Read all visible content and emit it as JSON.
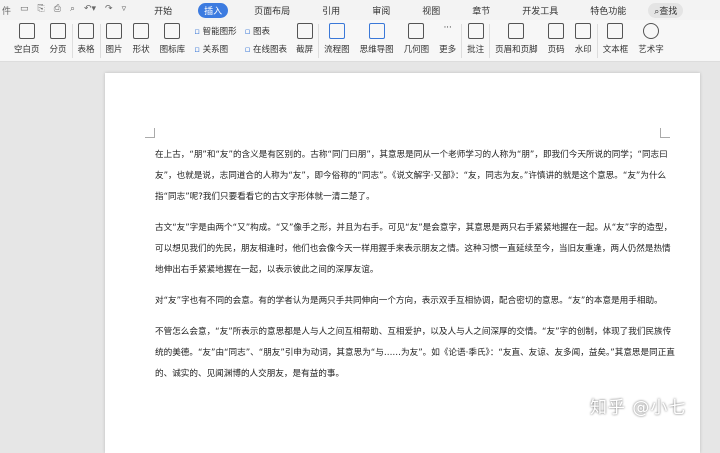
{
  "quick_access": {
    "file_label": "件"
  },
  "tabs": [
    "开始",
    "插入",
    "页面布局",
    "引用",
    "审阅",
    "视图",
    "章节",
    "开发工具",
    "特色功能"
  ],
  "active_tab": "插入",
  "search_label": "查找",
  "ribbon": {
    "blank_page": "空白页",
    "page_break": "分页",
    "table": "表格",
    "picture": "图片",
    "shape": "形状",
    "icon_lib": "图标库",
    "smart_art": "智能图形",
    "relation": "关系图",
    "chart": "图表",
    "online_chart": "在线图表",
    "screenshot": "截屏",
    "flowchart": "流程图",
    "mindmap": "思维导图",
    "geometry": "几何图",
    "more": "更多",
    "comment": "批注",
    "header_footer": "页眉和页脚",
    "page_number": "页码",
    "watermark": "水印",
    "textbox": "文本框",
    "wordart": "艺术字"
  },
  "document": {
    "paragraphs": [
      "在上古，“朋”和“友”的含义是有区别的。古称“同门曰朋”，其意思是同从一个老师学习的人称为“朋”，即我们今天所说的同学；“同志曰友”，也就是说，志同道合的人称为“友”，即今俗称的“同志”。《说文解字·又部》：“友，同志为友。”许慎讲的就是这个意思。“友”为什么指“同志”呢?我们只要看看它的古文字形体就一清二楚了。",
      "古文“友”字是由两个“又”构成。“又”像手之形，并且为右手。可见“友”是会意字，其意思是两只右手紧紧地握在一起。从“友”字的造型，可以想见我们的先民，朋友相逢时，他们也会像今天一样用握手来表示朋友之情。这种习惯一直延续至今，当旧友重逢，两人仍然是热情地伸出右手紧紧地握在一起，以表示彼此之间的深厚友谊。",
      "对“友”字也有不同的会意。有的学者认为是两只手共同伸向一个方向，表示双手互相协调，配合密切的意思。“友”的本意是用手相助。",
      "不管怎么会意，“友”所表示的意思都是人与人之间互相帮助、互相爱护，以及人与人之间深厚的交情。“友”字的创制，体现了我们民族传统的美德。“友”由“同志”、“朋友”引申为动词，其意思为“与……为友”。如《论语·季氏》：“友直、友谅、友多闻，益矣。”其意思是同正直的、诚实的、见闻渊博的人交朋友，是有益的事。"
    ]
  },
  "watermark": "知乎 @小七"
}
